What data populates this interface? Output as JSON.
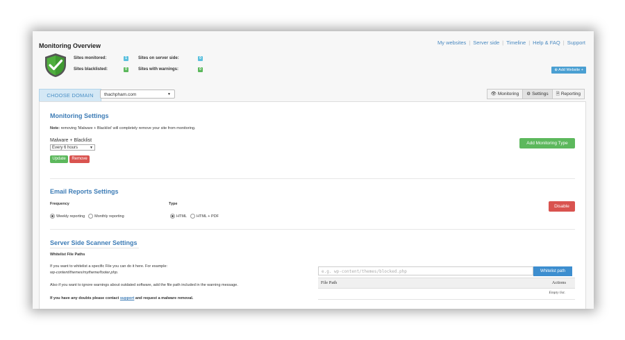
{
  "header": {
    "title": "Monitoring Overview",
    "nav": [
      "My websites",
      "Server side",
      "Timeline",
      "Help & FAQ",
      "Support"
    ],
    "add_website": "Add Website"
  },
  "stats": {
    "sites_monitored": {
      "label": "Sites monitored:",
      "value": "1"
    },
    "sites_blacklisted": {
      "label": "Sites blacklisted:",
      "value": "0"
    },
    "sites_server_side": {
      "label": "Sites on server side:",
      "value": "0"
    },
    "sites_warnings": {
      "label": "Sites with warnings:",
      "value": "0"
    }
  },
  "domain": {
    "label": "CHOOSE DOMAIN",
    "selected": "thachpham.com"
  },
  "tabs": [
    "Monitoring",
    "Settings",
    "Reporting"
  ],
  "active_tab": "Settings",
  "monitoring": {
    "title": "Monitoring Settings",
    "note_label": "Note:",
    "note_text": "removing 'Malware + Blacklist' will completely remove your site from monitoring.",
    "type_label": "Malware + Blacklist",
    "interval": "Every 6 hours",
    "update": "Update",
    "remove": "Remove",
    "add_type": "Add Monitoring Type"
  },
  "email": {
    "title": "Email Reports Settings",
    "frequency_label": "Frequency",
    "frequency_options": [
      "Weekly reporting",
      "Monthly reporting"
    ],
    "frequency_selected": "Weekly reporting",
    "type_label": "Type",
    "type_options": [
      "HTML",
      "HTML + PDF"
    ],
    "type_selected": "HTML",
    "disable": "Disable"
  },
  "scanner": {
    "title": "Server Side Scanner Settings",
    "subtitle": "Whitelist File Paths",
    "text1": "If you want to whitelist a specific File you can do it here. For example:",
    "example_path": "wp-content/themes/mytheme/footer.php.",
    "text2": "Also if you want to ignore warnings about outdated software, add the file path included in the warning message.",
    "text3_before": "If you have any doubts please contact",
    "text3_link": "support",
    "text3_after": "and request a malware removal.",
    "input_placeholder": "e.g. wp-content/themes/blocked.php",
    "whitelist_button": "Whitelist path",
    "col_file": "File Path",
    "col_actions": "Actions",
    "empty": "Empty list."
  },
  "colors": {
    "accent_blue": "#3d7cb6",
    "green": "#5cb85c",
    "red": "#d9534f",
    "badge_blue": "#5bc0de"
  },
  "icons": {
    "shield": "shield-check-icon",
    "plus": "plus-icon",
    "eye": "eye-icon",
    "gear": "gear-icon",
    "doc": "document-icon",
    "caret": "caret-down-icon"
  }
}
